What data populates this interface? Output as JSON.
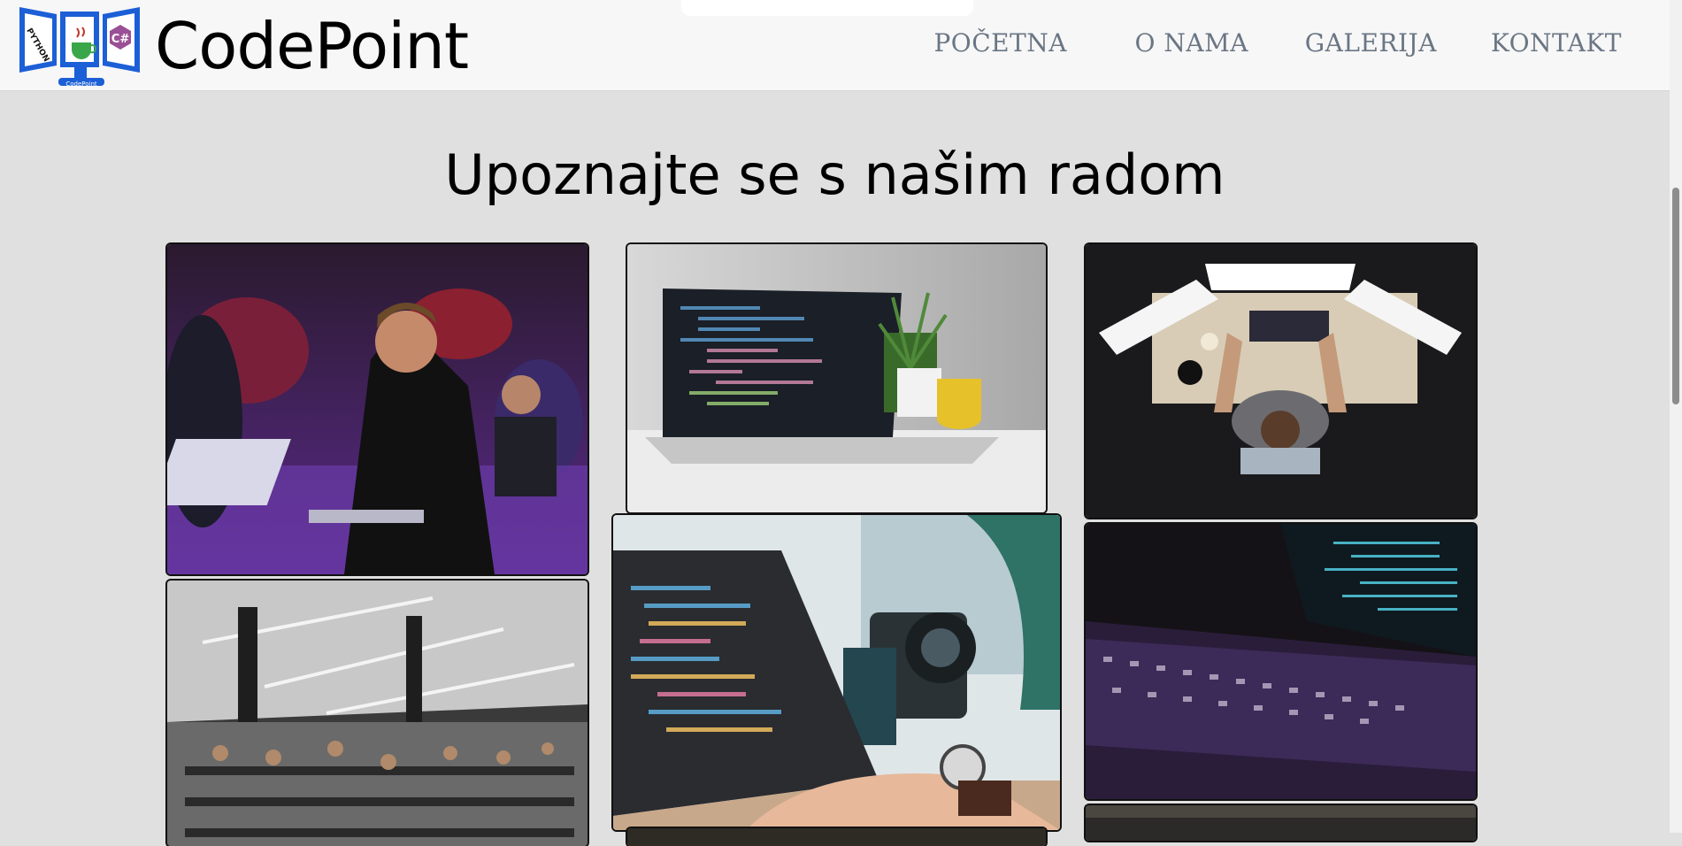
{
  "header": {
    "brand": "CodePoint",
    "logo_caption": "CodePoint",
    "logo_panels": [
      "python-logo",
      "java-logo",
      "csharp-logo"
    ],
    "logo_text_python": "PYTHON",
    "logo_text_csharp": "C#",
    "nav": [
      "POČETNA",
      "O NAMA",
      "GALERIJA",
      "KONTAKT"
    ]
  },
  "gallery": {
    "title": "Upoznajte se s našim radom",
    "photos": [
      "coders-with-laptops-at-event",
      "laptop-with-code-on-desk",
      "person-at-three-monitor-desk",
      "large-open-office-workspace",
      "hands-typing-code-on-laptop",
      "dark-laptop-keyboard-with-code",
      "partially-visible-photo",
      "partially-visible-photo"
    ]
  },
  "colors": {
    "header_bg": "#f7f7f7",
    "page_bg": "#e0e0e0",
    "nav_text": "#6a7684",
    "logo_blue": "#1c5fd6"
  }
}
